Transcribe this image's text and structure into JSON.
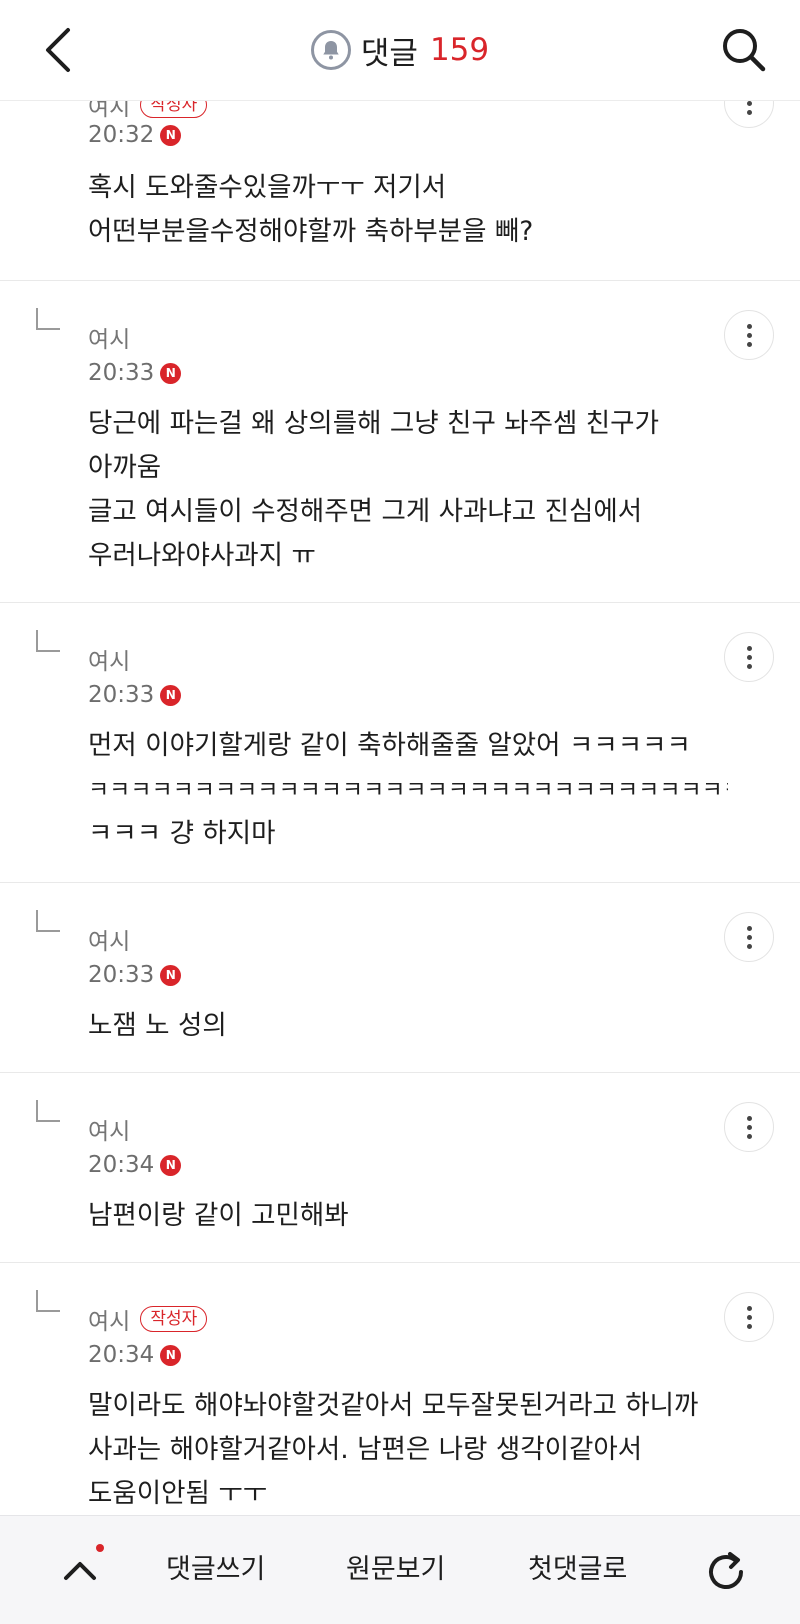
{
  "header": {
    "title": "댓글",
    "count": "159"
  },
  "comments": [
    {
      "author": "여시",
      "badge": "작성자",
      "time": "20:32",
      "new_badge": "N",
      "lines": [
        "혹시 도와줄수있을까ㅜㅜ 저기서",
        "어떤부분을수정해야할까 축하부분을 빼?"
      ]
    },
    {
      "author": "여시",
      "badge": "",
      "time": "20:33",
      "new_badge": "N",
      "lines": [
        "당근에 파는걸 왜 상의를해 그냥 친구 놔주셈 친구가",
        "아까움",
        "글고 여시들이 수정해주면 그게 사과냐고 진심에서",
        "우러나와야사과지 ㅠ"
      ]
    },
    {
      "author": "여시",
      "badge": "",
      "time": "20:33",
      "new_badge": "N",
      "lines": [
        "먼저 이야기할게랑 같이 축하해줄줄 알았어 ㅋㅋㅋㅋㅋ",
        "ㅋㅋㅋㅋㅋㅋㅋㅋㅋㅋㅋㅋㅋㅋㅋㅋㅋㅋㅋㅋㅋㅋㅋㅋㅋㅋㅋㅋㅋㅋㅋ",
        "ㅋㅋㅋ 걍 하지마"
      ]
    },
    {
      "author": "여시",
      "badge": "",
      "time": "20:33",
      "new_badge": "N",
      "lines": [
        "노잼 노 성의"
      ]
    },
    {
      "author": "여시",
      "badge": "",
      "time": "20:34",
      "new_badge": "N",
      "lines": [
        "남편이랑 같이 고민해봐"
      ]
    },
    {
      "author": "여시",
      "badge": "작성자",
      "time": "20:34",
      "new_badge": "N",
      "lines": [
        "말이라도 해야놔야할것같아서 모두잘못된거라고 하니까",
        "사과는 해야할거같아서. 남편은 나랑 생각이같아서",
        "도움이안됨 ㅜㅜ"
      ]
    }
  ],
  "bottom_bar": {
    "write": "댓글쓰기",
    "original": "원문보기",
    "first": "첫댓글로"
  },
  "icons": {
    "back": "back-arrow-icon",
    "bell": "bell-icon",
    "search": "search-icon",
    "more": "more-vertical-icon",
    "up": "chevron-up-icon",
    "refresh": "refresh-icon"
  },
  "colors": {
    "accent": "#d9252a",
    "meta_text": "#757575",
    "bottom_bar_bg": "#f6f6f8"
  }
}
